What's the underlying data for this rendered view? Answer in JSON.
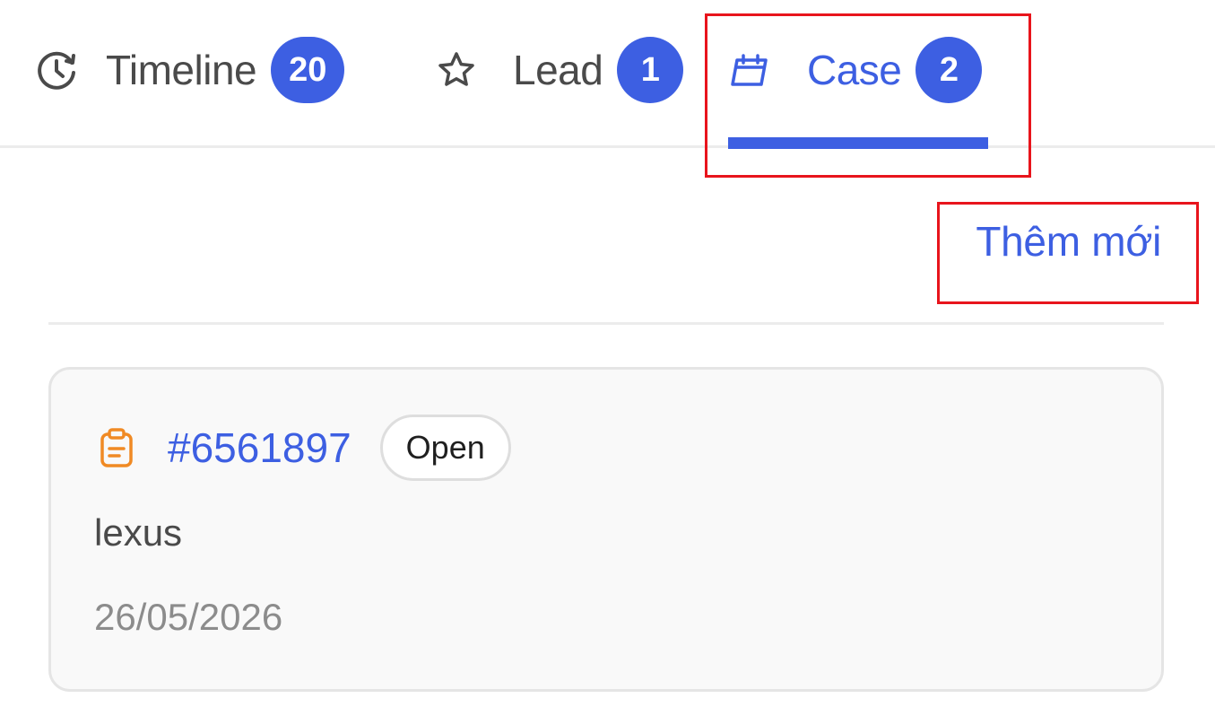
{
  "tabs": [
    {
      "label": "Timeline",
      "count": "20",
      "icon": "clock-history-icon",
      "active": false
    },
    {
      "label": "Lead",
      "count": "1",
      "icon": "star-icon",
      "active": false
    },
    {
      "label": "Case",
      "count": "2",
      "icon": "calendar-icon",
      "active": true
    }
  ],
  "actions": {
    "add_new_label": "Thêm mới"
  },
  "cases": [
    {
      "id": "#6561897",
      "status": "Open",
      "name": "lexus",
      "date": "26/05/2026",
      "icon": "clipboard-icon"
    }
  ],
  "colors": {
    "accent": "#3d5fe2",
    "highlight": "#e8141c",
    "case_icon": "#f08a24",
    "muted_text": "#8c8c8c"
  }
}
